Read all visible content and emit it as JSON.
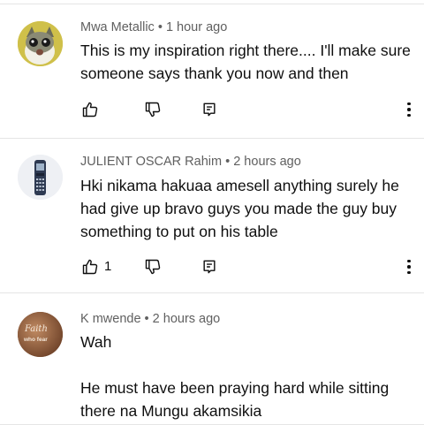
{
  "comments": [
    {
      "author": "Mwa Metallic",
      "separator": "•",
      "time": "1 hour ago",
      "text": "This is my inspiration right there.... I'll make sure someone says thank you now and then",
      "likes": ""
    },
    {
      "author": "JULIENT OSCAR Rahim",
      "separator": "•",
      "time": "2 hours ago",
      "text": "Hki nikama hakuaa amesell anything surely he had give up bravo guys you made the guy buy something to put on his table",
      "likes": "1"
    },
    {
      "author": "K mwende",
      "separator": "•",
      "time": "2 hours ago",
      "text": "Wah\n\nHe must have been praying hard while sitting there na Mungu akamsikia",
      "likes": ""
    }
  ],
  "avatar3_text": [
    "Faith",
    "who fear"
  ],
  "icons": {
    "like": "thumbs-up-icon",
    "dislike": "thumbs-down-icon",
    "reply": "reply-comment-icon",
    "more": "more-vertical-icon"
  },
  "colors": {
    "text": "#0f0f0f",
    "meta": "#606060",
    "divider": "#e5e5e5"
  }
}
